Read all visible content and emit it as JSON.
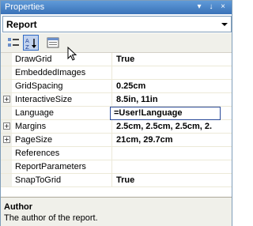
{
  "window": {
    "title": "Properties",
    "pin_glyph": "↓",
    "close_glyph": "×",
    "menu_glyph": "▾"
  },
  "object_selector": {
    "value": "Report"
  },
  "toolbar": {
    "categorized_tooltip": "Categorized",
    "alphabetical_tooltip": "Alphabetical",
    "pages_tooltip": "Property Pages"
  },
  "properties": [
    {
      "name": "DrawGrid",
      "value": "True",
      "expandable": false
    },
    {
      "name": "EmbeddedImages",
      "value": "",
      "expandable": false
    },
    {
      "name": "GridSpacing",
      "value": "0.25cm",
      "expandable": false
    },
    {
      "name": "InteractiveSize",
      "value": "8.5in, 11in",
      "expandable": true
    },
    {
      "name": "Language",
      "value": "=User!Language",
      "expandable": false,
      "editing": true
    },
    {
      "name": "Margins",
      "value": "2.5cm, 2.5cm, 2.5cm, 2.",
      "expandable": true
    },
    {
      "name": "PageSize",
      "value": "21cm, 29.7cm",
      "expandable": true
    },
    {
      "name": "References",
      "value": "",
      "expandable": false
    },
    {
      "name": "ReportParameters",
      "value": "",
      "expandable": false
    },
    {
      "name": "SnapToGrid",
      "value": "True",
      "expandable": false
    }
  ],
  "description": {
    "title": "Author",
    "text": "The author of the report."
  },
  "colors": {
    "title_bar": "#3a72b8",
    "edit_border": "#2a4a9a",
    "active_button": "#c1d2ee"
  }
}
